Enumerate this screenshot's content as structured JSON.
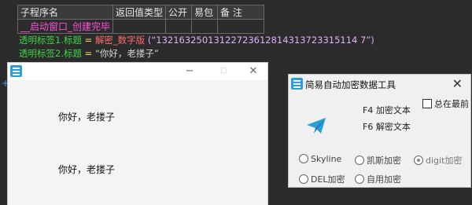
{
  "table": {
    "headers": [
      "子程序名",
      "返回值类型",
      "公开",
      "易包",
      "备 注"
    ],
    "row": [
      "__启动窗口_创建完毕",
      "",
      "",
      "",
      ""
    ]
  },
  "code": {
    "line1": {
      "target": "透明标签1.标题",
      "eq": " = ",
      "func": "解密_数字版",
      "arg": " (“13216325013122723612814313723315114 7”)"
    },
    "line2": {
      "target": "透明标签2.标题",
      "eq": " = ",
      "str": "“你好，老搂子”"
    }
  },
  "window_left": {
    "minimize": "−",
    "maximize": "☐",
    "close": "✕",
    "label1": "你好，老搂子",
    "label2": "你好，老搂子"
  },
  "tool_window": {
    "title": "简易自动加密数据工具",
    "close": "✕",
    "hotkey_encrypt": "F4 加密文本",
    "hotkey_decrypt": "F6 解密文本",
    "always_on_top": "总在最前",
    "radios": [
      {
        "label": "Skyline",
        "selected": false
      },
      {
        "label": "凯斯加密",
        "selected": false
      },
      {
        "label": "digit加密",
        "selected": true
      },
      {
        "label": "DEL加密",
        "selected": false
      },
      {
        "label": "自用加密",
        "selected": false
      }
    ]
  },
  "colors": {
    "accent": "#2a9ed6",
    "editor_bg": "#2b2b2b"
  }
}
